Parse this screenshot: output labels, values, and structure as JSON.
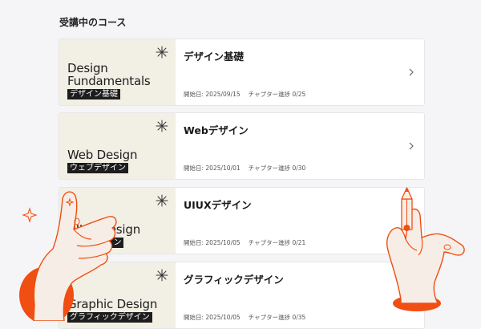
{
  "section": {
    "title": "受講中のコース"
  },
  "courses": [
    {
      "thumb_title": "Design\nFundamentals",
      "thumb_sub": "デザイン基礎",
      "name": "デザイン基礎",
      "start_label": "開始日: 2025/09/15",
      "progress_label": "チャプター進捗 0/25"
    },
    {
      "thumb_title": "Web Design",
      "thumb_sub": "ウェブデザイン",
      "name": "Webデザイン",
      "start_label": "開始日: 2025/10/01",
      "progress_label": "チャプター進捗 0/30"
    },
    {
      "thumb_title": "UIUX Design",
      "thumb_sub": "UIUXデザイン",
      "name": "UIUXデザイン",
      "start_label": "開始日: 2025/10/05",
      "progress_label": "チャプター進捗 0/21"
    },
    {
      "thumb_title": "Graphic Design",
      "thumb_sub": "グラフィックデザイン",
      "name": "グラフィックデザイン",
      "start_label": "開始日: 2025/10/05",
      "progress_label": "チャプター進捗 0/35"
    }
  ],
  "icons": {
    "sparkle": "sparkle-icon",
    "chevron": "chevron-right-icon"
  },
  "colors": {
    "accent": "#f04e12",
    "thumb_bg": "#f2efe5",
    "skin": "#f6eee6"
  }
}
